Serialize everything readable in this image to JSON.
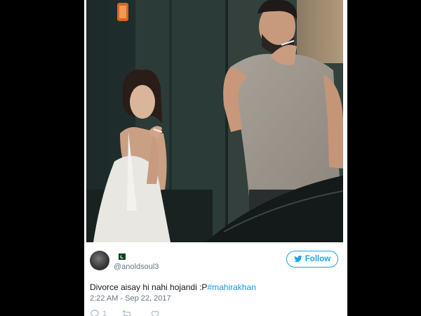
{
  "tweet": {
    "handle": "@anoldsoul3",
    "text": "Divorce aisay hi nahi hojandi :P",
    "hashtag": "#mahirakhan",
    "timestamp": "2:22 AM - Sep 22, 2017",
    "follow_label": "Follow",
    "reply_count": "1",
    "retweet_count": "",
    "like_count": ""
  },
  "icons": {
    "avatar": "user-avatar",
    "flag": "pakistan-flag-icon",
    "follow": "twitter-bird-icon",
    "reply": "reply-icon",
    "retweet": "retweet-icon",
    "like": "heart-icon"
  },
  "colors": {
    "twitter_blue": "#1da1f2",
    "hashtag": "#1b95e0",
    "meta_gray": "#657786",
    "background": "#000000"
  }
}
